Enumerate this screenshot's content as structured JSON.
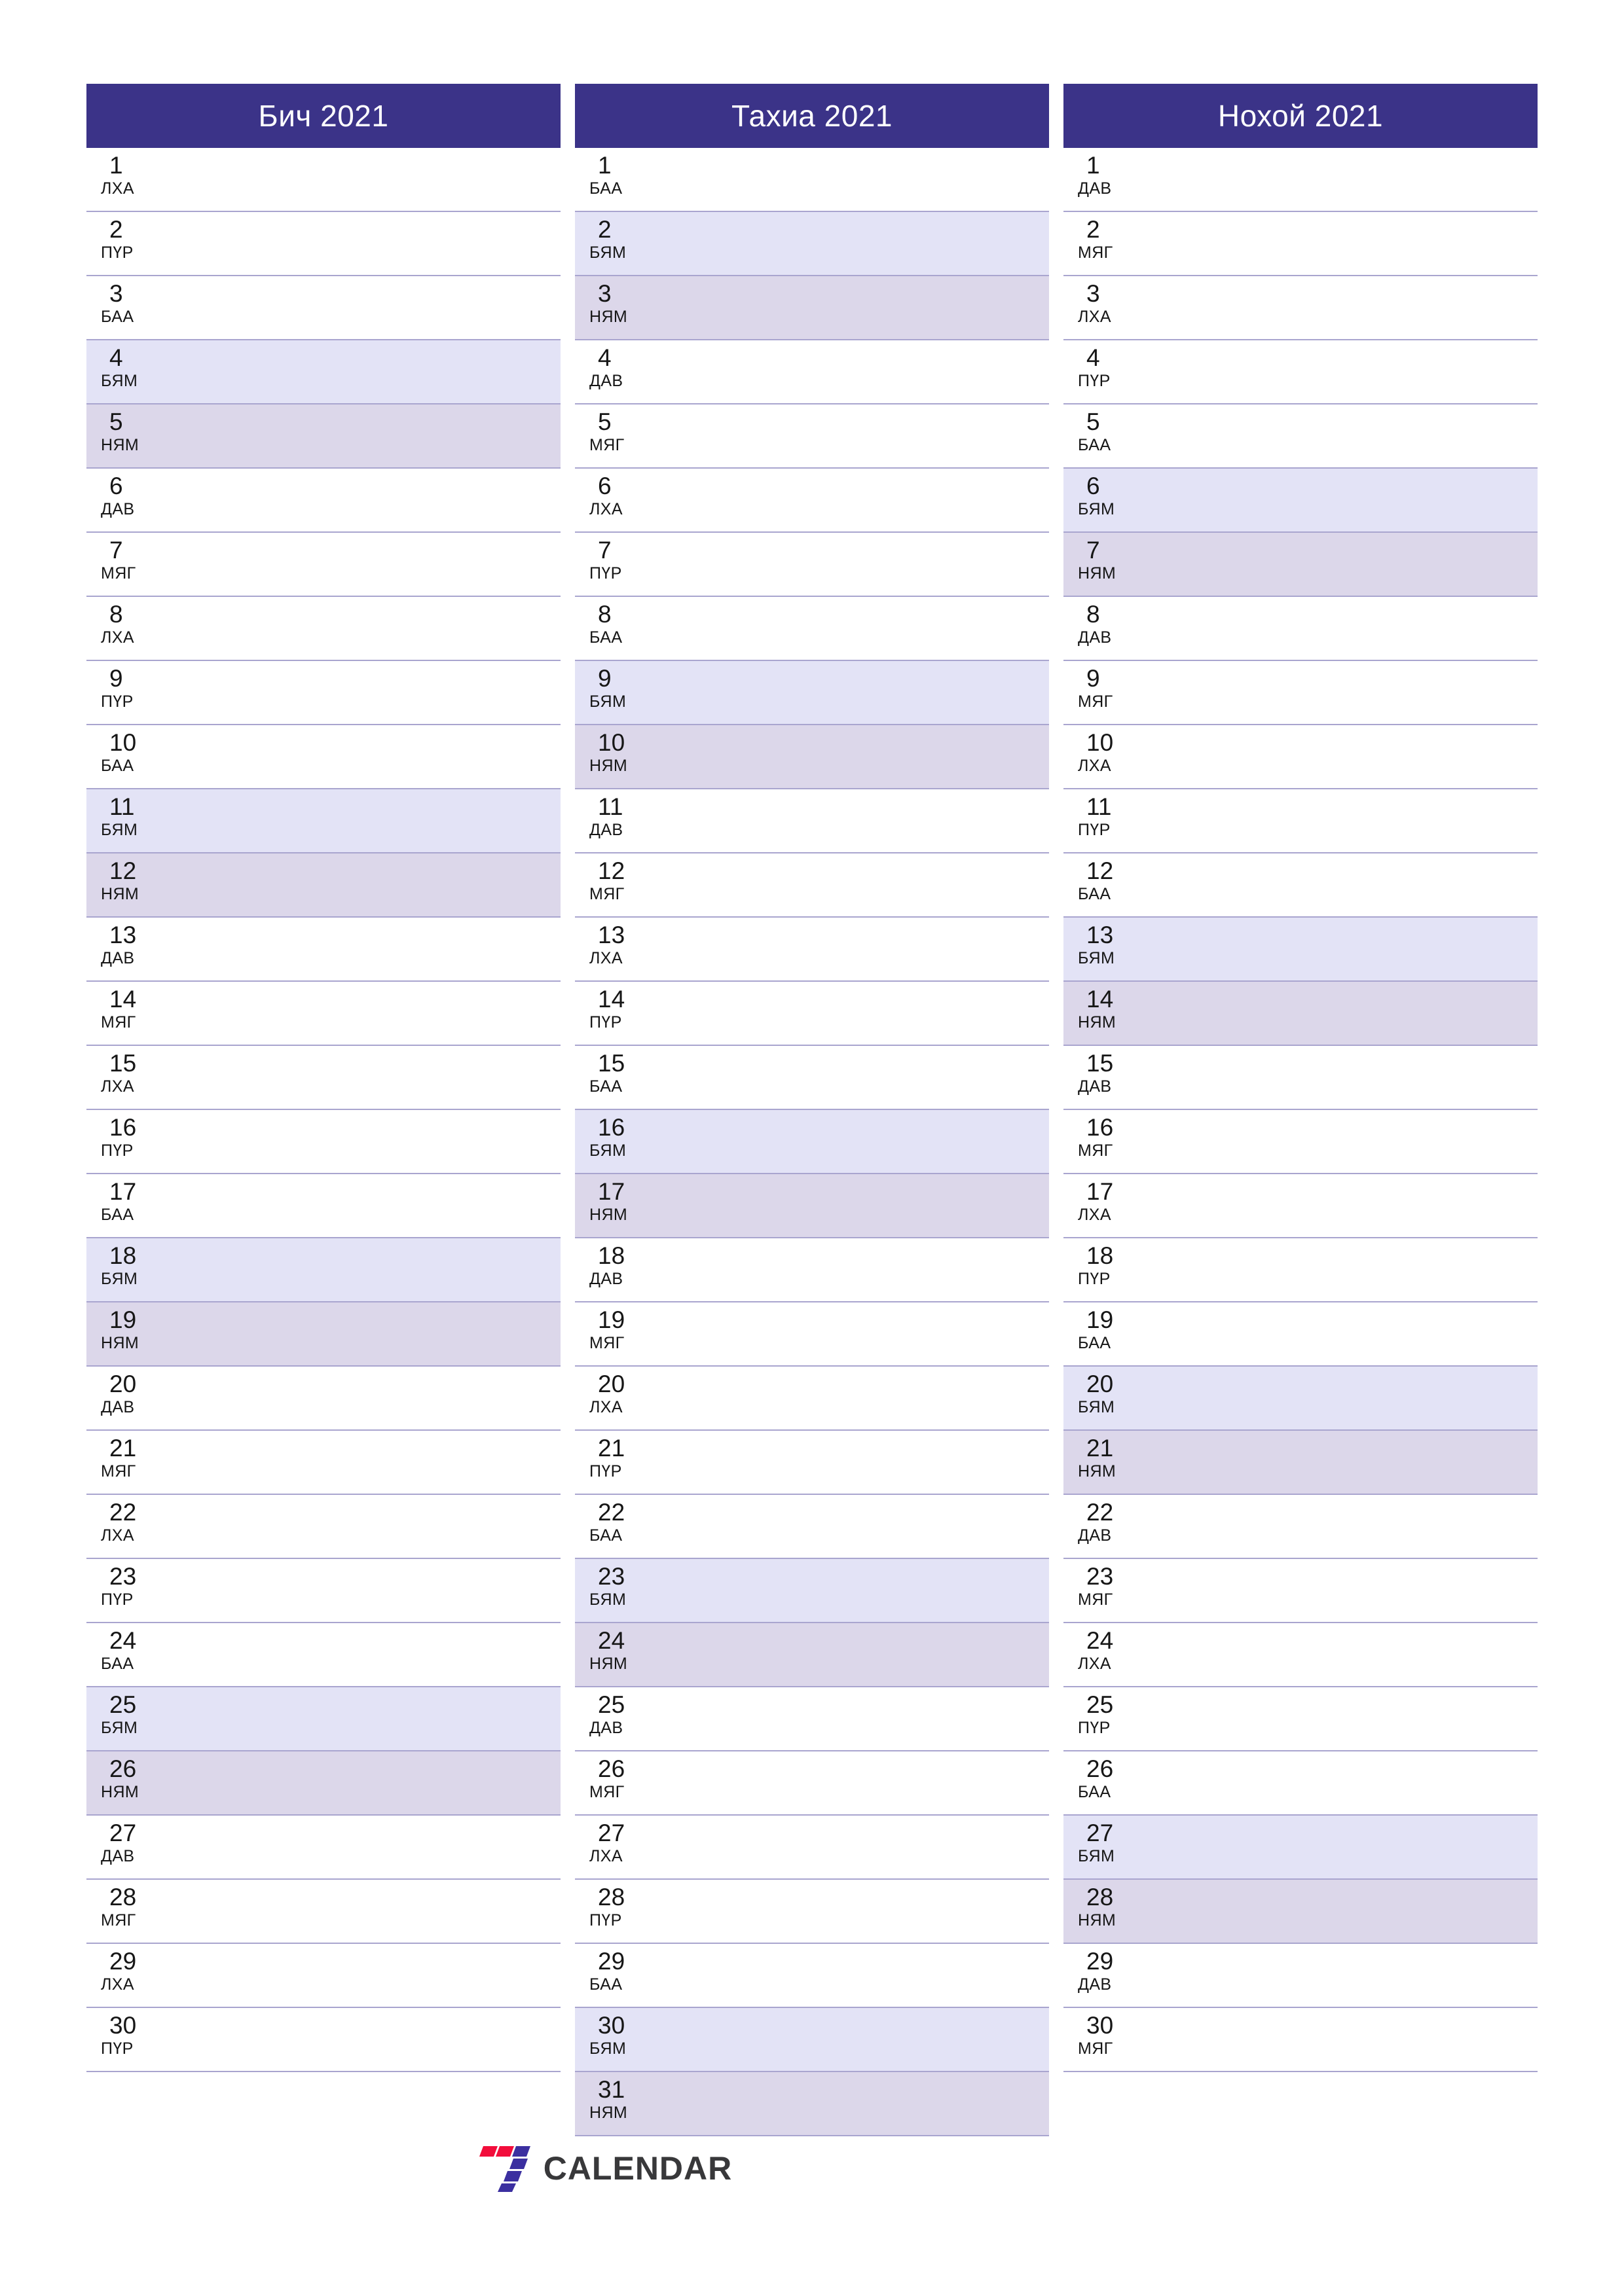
{
  "document": {
    "type": "three-month-calendar-planner",
    "year": "2021",
    "language": "mn"
  },
  "colors": {
    "header_bg": "#3b3388",
    "header_text": "#ffffff",
    "saturday_bg": "#e3e3f6",
    "sunday_bg": "#dcd7ea",
    "row_border": "#a9a5cf",
    "day_text": "#161616",
    "logo_red": "#f20d3b",
    "logo_purple": "#3b2fa0",
    "logo_text": "#38383a"
  },
  "weekday_names": {
    "mon": "ДАВ",
    "tue": "МЯГ",
    "wed": "ЛХА",
    "thu": "ПҮР",
    "fri": "БАА",
    "sat": "БЯМ",
    "sun": "НЯМ"
  },
  "months": [
    {
      "title": "Бич 2021",
      "days": [
        {
          "n": "1",
          "wd": "ЛХА",
          "type": "weekday"
        },
        {
          "n": "2",
          "wd": "ПҮР",
          "type": "weekday"
        },
        {
          "n": "3",
          "wd": "БАА",
          "type": "weekday"
        },
        {
          "n": "4",
          "wd": "БЯМ",
          "type": "sat"
        },
        {
          "n": "5",
          "wd": "НЯМ",
          "type": "sun"
        },
        {
          "n": "6",
          "wd": "ДАВ",
          "type": "weekday"
        },
        {
          "n": "7",
          "wd": "МЯГ",
          "type": "weekday"
        },
        {
          "n": "8",
          "wd": "ЛХА",
          "type": "weekday"
        },
        {
          "n": "9",
          "wd": "ПҮР",
          "type": "weekday"
        },
        {
          "n": "10",
          "wd": "БАА",
          "type": "weekday"
        },
        {
          "n": "11",
          "wd": "БЯМ",
          "type": "sat"
        },
        {
          "n": "12",
          "wd": "НЯМ",
          "type": "sun"
        },
        {
          "n": "13",
          "wd": "ДАВ",
          "type": "weekday"
        },
        {
          "n": "14",
          "wd": "МЯГ",
          "type": "weekday"
        },
        {
          "n": "15",
          "wd": "ЛХА",
          "type": "weekday"
        },
        {
          "n": "16",
          "wd": "ПҮР",
          "type": "weekday"
        },
        {
          "n": "17",
          "wd": "БАА",
          "type": "weekday"
        },
        {
          "n": "18",
          "wd": "БЯМ",
          "type": "sat"
        },
        {
          "n": "19",
          "wd": "НЯМ",
          "type": "sun"
        },
        {
          "n": "20",
          "wd": "ДАВ",
          "type": "weekday"
        },
        {
          "n": "21",
          "wd": "МЯГ",
          "type": "weekday"
        },
        {
          "n": "22",
          "wd": "ЛХА",
          "type": "weekday"
        },
        {
          "n": "23",
          "wd": "ПҮР",
          "type": "weekday"
        },
        {
          "n": "24",
          "wd": "БАА",
          "type": "weekday"
        },
        {
          "n": "25",
          "wd": "БЯМ",
          "type": "sat"
        },
        {
          "n": "26",
          "wd": "НЯМ",
          "type": "sun"
        },
        {
          "n": "27",
          "wd": "ДАВ",
          "type": "weekday"
        },
        {
          "n": "28",
          "wd": "МЯГ",
          "type": "weekday"
        },
        {
          "n": "29",
          "wd": "ЛХА",
          "type": "weekday"
        },
        {
          "n": "30",
          "wd": "ПҮР",
          "type": "weekday"
        }
      ]
    },
    {
      "title": "Тахиа 2021",
      "days": [
        {
          "n": "1",
          "wd": "БАА",
          "type": "weekday"
        },
        {
          "n": "2",
          "wd": "БЯМ",
          "type": "sat"
        },
        {
          "n": "3",
          "wd": "НЯМ",
          "type": "sun"
        },
        {
          "n": "4",
          "wd": "ДАВ",
          "type": "weekday"
        },
        {
          "n": "5",
          "wd": "МЯГ",
          "type": "weekday"
        },
        {
          "n": "6",
          "wd": "ЛХА",
          "type": "weekday"
        },
        {
          "n": "7",
          "wd": "ПҮР",
          "type": "weekday"
        },
        {
          "n": "8",
          "wd": "БАА",
          "type": "weekday"
        },
        {
          "n": "9",
          "wd": "БЯМ",
          "type": "sat"
        },
        {
          "n": "10",
          "wd": "НЯМ",
          "type": "sun"
        },
        {
          "n": "11",
          "wd": "ДАВ",
          "type": "weekday"
        },
        {
          "n": "12",
          "wd": "МЯГ",
          "type": "weekday"
        },
        {
          "n": "13",
          "wd": "ЛХА",
          "type": "weekday"
        },
        {
          "n": "14",
          "wd": "ПҮР",
          "type": "weekday"
        },
        {
          "n": "15",
          "wd": "БАА",
          "type": "weekday"
        },
        {
          "n": "16",
          "wd": "БЯМ",
          "type": "sat"
        },
        {
          "n": "17",
          "wd": "НЯМ",
          "type": "sun"
        },
        {
          "n": "18",
          "wd": "ДАВ",
          "type": "weekday"
        },
        {
          "n": "19",
          "wd": "МЯГ",
          "type": "weekday"
        },
        {
          "n": "20",
          "wd": "ЛХА",
          "type": "weekday"
        },
        {
          "n": "21",
          "wd": "ПҮР",
          "type": "weekday"
        },
        {
          "n": "22",
          "wd": "БАА",
          "type": "weekday"
        },
        {
          "n": "23",
          "wd": "БЯМ",
          "type": "sat"
        },
        {
          "n": "24",
          "wd": "НЯМ",
          "type": "sun"
        },
        {
          "n": "25",
          "wd": "ДАВ",
          "type": "weekday"
        },
        {
          "n": "26",
          "wd": "МЯГ",
          "type": "weekday"
        },
        {
          "n": "27",
          "wd": "ЛХА",
          "type": "weekday"
        },
        {
          "n": "28",
          "wd": "ПҮР",
          "type": "weekday"
        },
        {
          "n": "29",
          "wd": "БАА",
          "type": "weekday"
        },
        {
          "n": "30",
          "wd": "БЯМ",
          "type": "sat"
        },
        {
          "n": "31",
          "wd": "НЯМ",
          "type": "sun"
        }
      ]
    },
    {
      "title": "Нохой 2021",
      "days": [
        {
          "n": "1",
          "wd": "ДАВ",
          "type": "weekday"
        },
        {
          "n": "2",
          "wd": "МЯГ",
          "type": "weekday"
        },
        {
          "n": "3",
          "wd": "ЛХА",
          "type": "weekday"
        },
        {
          "n": "4",
          "wd": "ПҮР",
          "type": "weekday"
        },
        {
          "n": "5",
          "wd": "БАА",
          "type": "weekday"
        },
        {
          "n": "6",
          "wd": "БЯМ",
          "type": "sat"
        },
        {
          "n": "7",
          "wd": "НЯМ",
          "type": "sun"
        },
        {
          "n": "8",
          "wd": "ДАВ",
          "type": "weekday"
        },
        {
          "n": "9",
          "wd": "МЯГ",
          "type": "weekday"
        },
        {
          "n": "10",
          "wd": "ЛХА",
          "type": "weekday"
        },
        {
          "n": "11",
          "wd": "ПҮР",
          "type": "weekday"
        },
        {
          "n": "12",
          "wd": "БАА",
          "type": "weekday"
        },
        {
          "n": "13",
          "wd": "БЯМ",
          "type": "sat"
        },
        {
          "n": "14",
          "wd": "НЯМ",
          "type": "sun"
        },
        {
          "n": "15",
          "wd": "ДАВ",
          "type": "weekday"
        },
        {
          "n": "16",
          "wd": "МЯГ",
          "type": "weekday"
        },
        {
          "n": "17",
          "wd": "ЛХА",
          "type": "weekday"
        },
        {
          "n": "18",
          "wd": "ПҮР",
          "type": "weekday"
        },
        {
          "n": "19",
          "wd": "БАА",
          "type": "weekday"
        },
        {
          "n": "20",
          "wd": "БЯМ",
          "type": "sat"
        },
        {
          "n": "21",
          "wd": "НЯМ",
          "type": "sun"
        },
        {
          "n": "22",
          "wd": "ДАВ",
          "type": "weekday"
        },
        {
          "n": "23",
          "wd": "МЯГ",
          "type": "weekday"
        },
        {
          "n": "24",
          "wd": "ЛХА",
          "type": "weekday"
        },
        {
          "n": "25",
          "wd": "ПҮР",
          "type": "weekday"
        },
        {
          "n": "26",
          "wd": "БАА",
          "type": "weekday"
        },
        {
          "n": "27",
          "wd": "БЯМ",
          "type": "sat"
        },
        {
          "n": "28",
          "wd": "НЯМ",
          "type": "sun"
        },
        {
          "n": "29",
          "wd": "ДАВ",
          "type": "weekday"
        },
        {
          "n": "30",
          "wd": "МЯГ",
          "type": "weekday"
        }
      ]
    }
  ],
  "footer": {
    "logo_text": "CALENDAR",
    "logo_mark": "seven-slash-mark"
  }
}
